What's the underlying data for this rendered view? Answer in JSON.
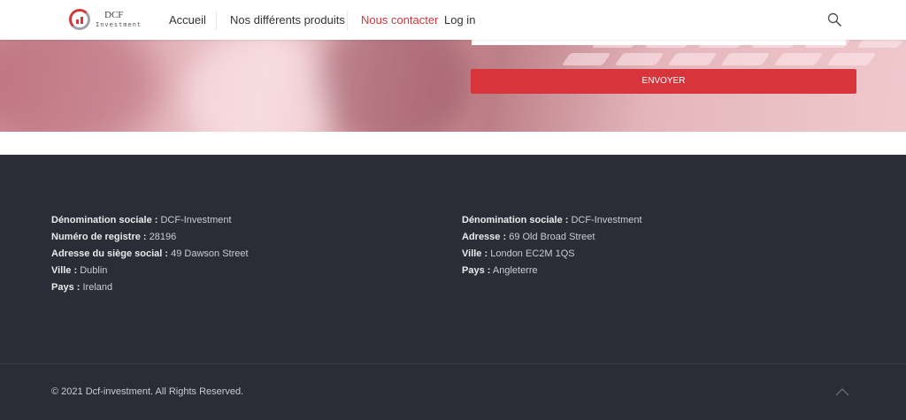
{
  "header": {
    "logo_name": "DCF",
    "logo_sub": "Investment",
    "nav": [
      {
        "label": "Accueil"
      },
      {
        "label": "Nos différents produits"
      },
      {
        "label": "Nous contacter"
      },
      {
        "label": "Log in"
      }
    ],
    "active_color": "#d8343b"
  },
  "form": {
    "submit_label": "ENVOYER"
  },
  "footer": {
    "left": [
      {
        "key": "Dénomination sociale :",
        "value": "DCF-Investment"
      },
      {
        "key": "Numéro de registre :",
        "value": "28196"
      },
      {
        "key": "Adresse du siège social :",
        "value": "49 Dawson Street"
      },
      {
        "key": "Ville :",
        "value": "Dublin"
      },
      {
        "key": "Pays :",
        "value": "Ireland"
      }
    ],
    "right": [
      {
        "key": "Dénomination sociale :",
        "value": "DCF-Investment"
      },
      {
        "key": "Adresse :",
        "value": "69 Old Broad Street"
      },
      {
        "key": "Ville :",
        "value": "London EC2M 1QS"
      },
      {
        "key": "Pays :",
        "value": "Angleterre"
      }
    ],
    "copyright": "© 2021 Dcf-investment. All Rights Reserved."
  },
  "icons": {
    "search": "search-icon",
    "back_to_top": "chevron-up-icon"
  }
}
